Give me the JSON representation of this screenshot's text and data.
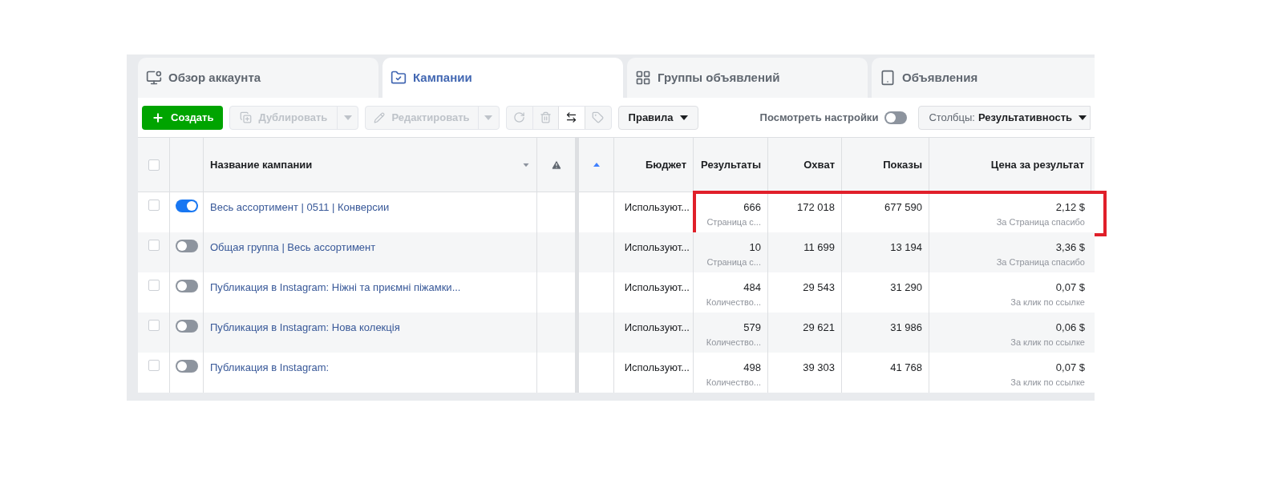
{
  "tabs": [
    {
      "label": "Обзор аккаунта",
      "selected": false
    },
    {
      "label": "Кампании",
      "selected": true
    },
    {
      "label": "Группы объявлений",
      "selected": false
    },
    {
      "label": "Объявления",
      "selected": false
    }
  ],
  "toolbar": {
    "create": "Создать",
    "duplicate": "Дублировать",
    "edit": "Редактировать",
    "rules": "Правила",
    "view_settings": {
      "label": "Посмотреть настройки",
      "on": false
    },
    "columns": {
      "label": "Столбцы:",
      "value": "Результативность"
    }
  },
  "table": {
    "header_checked": false,
    "columns": [
      "Название кампании",
      "Бюджет",
      "Результаты",
      "Охват",
      "Показы",
      "Цена за результат"
    ],
    "rows": [
      {
        "checked": false,
        "on": true,
        "name": "Весь ассортимент | 0511 | Конверсии",
        "budget": "Используют...",
        "results": "666",
        "results_sub": "Страница с...",
        "reach": "172 018",
        "impressions": "677 590",
        "cost": "2,12 $",
        "cost_sub": "За Страница спасибо",
        "highlighted": true
      },
      {
        "checked": false,
        "on": false,
        "name": "Общая группа | Весь ассортимент",
        "budget": "Используют...",
        "results": "10",
        "results_sub": "Страница с...",
        "reach": "11 699",
        "impressions": "13 194",
        "cost": "3,36 $",
        "cost_sub": "За Страница спасибо",
        "highlighted": false
      },
      {
        "checked": false,
        "on": false,
        "name": "Публикация в Instagram: Ніжні та приємні піжамки...",
        "budget": "Используют...",
        "results": "484",
        "results_sub": "Количество...",
        "reach": "29 543",
        "impressions": "31 290",
        "cost": "0,07 $",
        "cost_sub": "За клик по ссылке",
        "highlighted": false
      },
      {
        "checked": false,
        "on": false,
        "name": "Публикация в Instagram: Нова колекція",
        "budget": "Используют...",
        "results": "579",
        "results_sub": "Количество...",
        "reach": "29 621",
        "impressions": "31 986",
        "cost": "0,06 $",
        "cost_sub": "За клик по ссылке",
        "highlighted": false
      },
      {
        "checked": false,
        "on": false,
        "name": "Публикация в Instagram:",
        "budget": "Используют...",
        "results": "498",
        "results_sub": "Количество...",
        "reach": "39 303",
        "impressions": "41 768",
        "cost": "0,07 $",
        "cost_sub": "За клик по ссылке",
        "highlighted": false
      }
    ]
  }
}
